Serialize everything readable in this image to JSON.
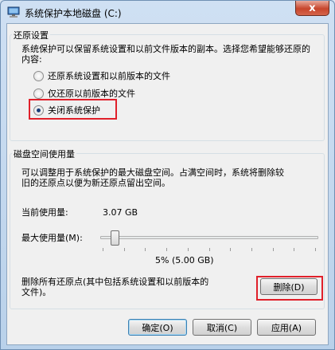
{
  "window": {
    "title": "系统保护本地磁盘 (C:)",
    "close_label": "x"
  },
  "restore_settings": {
    "group_title": "还原设置",
    "description": "系统保护可以保留系统设置和以前文件版本的副本。选择您希望能够还原的内容:",
    "options": [
      {
        "label": "还原系统设置和以前版本的文件",
        "checked": false
      },
      {
        "label": "仅还原以前版本的文件",
        "checked": false
      },
      {
        "label": "关闭系统保护",
        "checked": true
      }
    ]
  },
  "disk_usage": {
    "group_title": "磁盘空间使用量",
    "description_line1": "可以调整用于系统保护的最大磁盘空间。占满空间时，系统将删除较",
    "description_line2": "旧的还原点以便为新还原点留出空间。",
    "current_label": "当前使用量:",
    "current_value": "3.07 GB",
    "max_label": "最大使用量(M):",
    "max_value": "5% (5.00 GB)",
    "slider_fraction": 0.05,
    "delete_text_line1": "删除所有还原点(其中包括系统设置和以前版本的",
    "delete_text_line2": "文件)。",
    "delete_button": "删除(D)"
  },
  "footer": {
    "ok": "确定(O)",
    "cancel": "取消(C)",
    "apply": "应用(A)"
  },
  "colors": {
    "highlight": "#e0202a",
    "title_bar": "#c4d8ee"
  }
}
